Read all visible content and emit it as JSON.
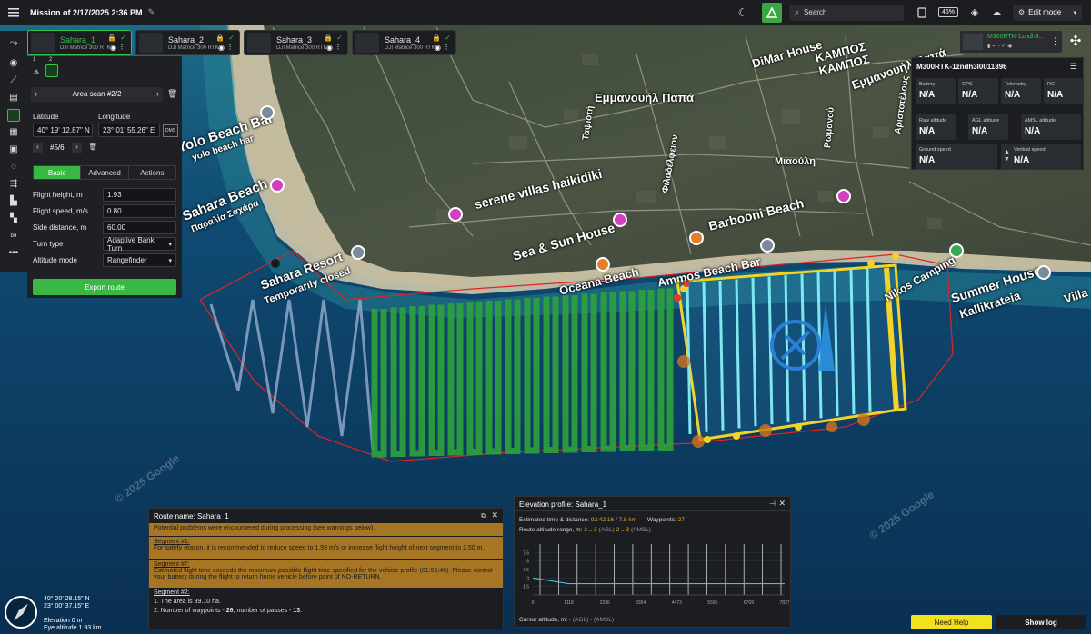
{
  "topbar": {
    "mission_title": "Mission of 2/17/2025 2:36 PM",
    "search_placeholder": "Search",
    "battery": "46%",
    "mode": "Edit mode",
    "accent": "#39c24a"
  },
  "drones": [
    {
      "name": "Sahara_1",
      "model": "DJI Matrice 300 RTK",
      "active": true
    },
    {
      "name": "Sahara_2",
      "model": "DJI Matrice 300 RTK",
      "active": false
    },
    {
      "name": "Sahara_3",
      "model": "DJI Matrice 300 RTK",
      "active": false
    },
    {
      "name": "Sahara_4",
      "model": "DJI Matrice 300 RTK",
      "active": false
    }
  ],
  "left_panel": {
    "step_tabs": [
      "1",
      "2"
    ],
    "nav_title": "Area scan #2/2",
    "latitude_label": "Latitude",
    "longitude_label": "Longitude",
    "latitude_value": "40° 19' 12.87\" N",
    "longitude_value": "23° 01' 55.26\" E",
    "dms_label": "DMS",
    "point_counter": "#5/6",
    "tabs": [
      "Basic",
      "Advanced",
      "Actions"
    ],
    "fields": [
      {
        "label": "Flight height, m",
        "value": "1.93"
      },
      {
        "label": "Flight speed, m/s",
        "value": "0.80"
      },
      {
        "label": "Side distance, m",
        "value": "60.00"
      },
      {
        "label": "Turn type",
        "value": "Adaptive Bank Turn"
      },
      {
        "label": "Altitude mode",
        "value": "Rangefinder"
      }
    ],
    "export_button": "Export route"
  },
  "telemetry": {
    "device_chip": "M300RTK-1zndh3...",
    "device_id": "M300RTK-1zndh3l0011396",
    "metrics": [
      {
        "label": "Battery",
        "value": "N/A"
      },
      {
        "label": "GPS",
        "value": "N/A"
      },
      {
        "label": "Telemetry",
        "value": "N/A"
      },
      {
        "label": "RC",
        "value": "N/A"
      },
      {
        "label": "Raw altitude",
        "value": "N/A"
      },
      {
        "label": "AGL altitude",
        "value": "N/A"
      },
      {
        "label": "AMSL altitude",
        "value": "N/A"
      },
      {
        "label": "Ground speed",
        "value": "N/A"
      },
      {
        "label": "Vertical speed",
        "value": "N/A"
      }
    ]
  },
  "map_labels": [
    "Sahara Beach",
    "Παραλία Σαχάρα",
    "Yolo Beach Bar",
    "yolo beach bar",
    "serene villas haikidiki",
    "Sea & Sun House",
    "Barbooni Beach",
    "Ammos Beach Bar",
    "Oceana Beach",
    "Sahara Resort",
    "Temporarily closed",
    "DiMar House",
    "ΚΑΜΠΟΣ",
    "ΚΑΜΠΟΣ",
    "Εμμανουήλ Παπά",
    "Εμμανουήλ Παπά",
    "Μιαούλη",
    "Φιλαδέλφειον",
    "Ταψιοτή",
    "Ρωμανού",
    "Summer House",
    "Kallikrateia",
    "Villa",
    "Nikos Camping",
    "Αριστοτέλους",
    "© 2025 Google",
    "© 2025 Google"
  ],
  "route_panel": {
    "title": "Route name: Sahara_1",
    "warning_intro": "Potential problems were encountered during processing (see warnings below).",
    "seg1_title": "Segment #1:",
    "seg1_text": "For safety reason, it is recommended to reduce speed to 1.93 m/s or increase flight height of next segment to 2.50 m.",
    "seg7_title": "Segment #7:",
    "seg7_text": "Estimated flight time exceeds the maximum possible flight time specified for the vehicle profile (01:56:40). Please control your battery during the flight to return home vehicle before point of NO-RETURN.",
    "seg2_title": "Segment #2:",
    "seg2_line1": "1. The area is 39.10 ha.",
    "seg2_line2_prefix": "2. Number of waypoints - ",
    "seg2_waypoints": "26",
    "seg2_line2_mid": ", number of passes - ",
    "seg2_passes": "13",
    "seg2_line2_end": "."
  },
  "elevation_panel": {
    "title": "Elevation profile: Sahara_1",
    "est_label": "Estimated time & distance:",
    "est_time": "02:42:16",
    "est_dist": "7.8 km",
    "waypoints_label": "Waypoints:",
    "waypoints_value": "27",
    "range_label": "Route altitude range, m:",
    "range_agl_a": "2",
    "range_agl_b": "3",
    "agl_tag": "(AGL)",
    "range_amsl_a": "2",
    "range_amsl_b": "3",
    "amsl_tag": "(AMSL)",
    "cursor_label": "Cursor altitude, m:",
    "cursor_agl": "- (AGL)",
    "cursor_amsl": "- (AMSL)"
  },
  "chart_data": {
    "type": "line",
    "title": "",
    "x": [
      0,
      1118,
      2236,
      3354,
      4473,
      5591,
      6709,
      7827
    ],
    "xtick_labels": [
      "0",
      "1118",
      "2236",
      "3354",
      "4473",
      "5591",
      "6709",
      "7827"
    ],
    "ytick_labels": [
      "1.5",
      "3",
      "4.5",
      "6",
      "7.5"
    ],
    "ylim": [
      0,
      9
    ],
    "series": [
      {
        "values": [
          3,
          2,
          2,
          2,
          2,
          2,
          2,
          2
        ]
      }
    ],
    "waypoint_markers": 14,
    "grid": true
  },
  "coords": {
    "lat": "40° 20' 28.15\" N",
    "lon": "23° 00' 37.15\" E",
    "elevation": "Elevation 0 m",
    "eye": "Eye altitude 1.93 km"
  },
  "bottom": {
    "help": "Need Help",
    "log": "Show log"
  }
}
